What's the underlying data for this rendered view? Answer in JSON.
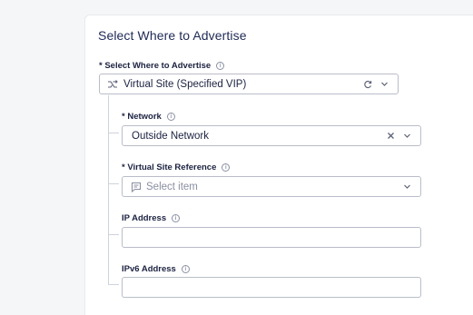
{
  "panel": {
    "title": "Select Where to Advertise"
  },
  "advertise": {
    "label": "* Select Where to Advertise",
    "value": "Virtual Site (Specified VIP)",
    "icon": "route-icon",
    "actions": [
      "refresh-icon",
      "chevron-down-icon"
    ]
  },
  "network": {
    "label": "* Network",
    "value": "Outside Network",
    "actions": [
      "clear-icon",
      "chevron-down-icon"
    ]
  },
  "virtual_site_reference": {
    "label": "* Virtual Site Reference",
    "placeholder": "Select item",
    "icon": "list-icon",
    "actions": [
      "chevron-down-icon"
    ]
  },
  "ip_address": {
    "label": "IP Address",
    "value": ""
  },
  "ipv6_address": {
    "label": "IPv6 Address",
    "value": ""
  },
  "colors": {
    "title": "#1f2a55",
    "border": "#b9bdc8",
    "tree_line": "#cfd3dc",
    "background": "#f5f6f8"
  }
}
